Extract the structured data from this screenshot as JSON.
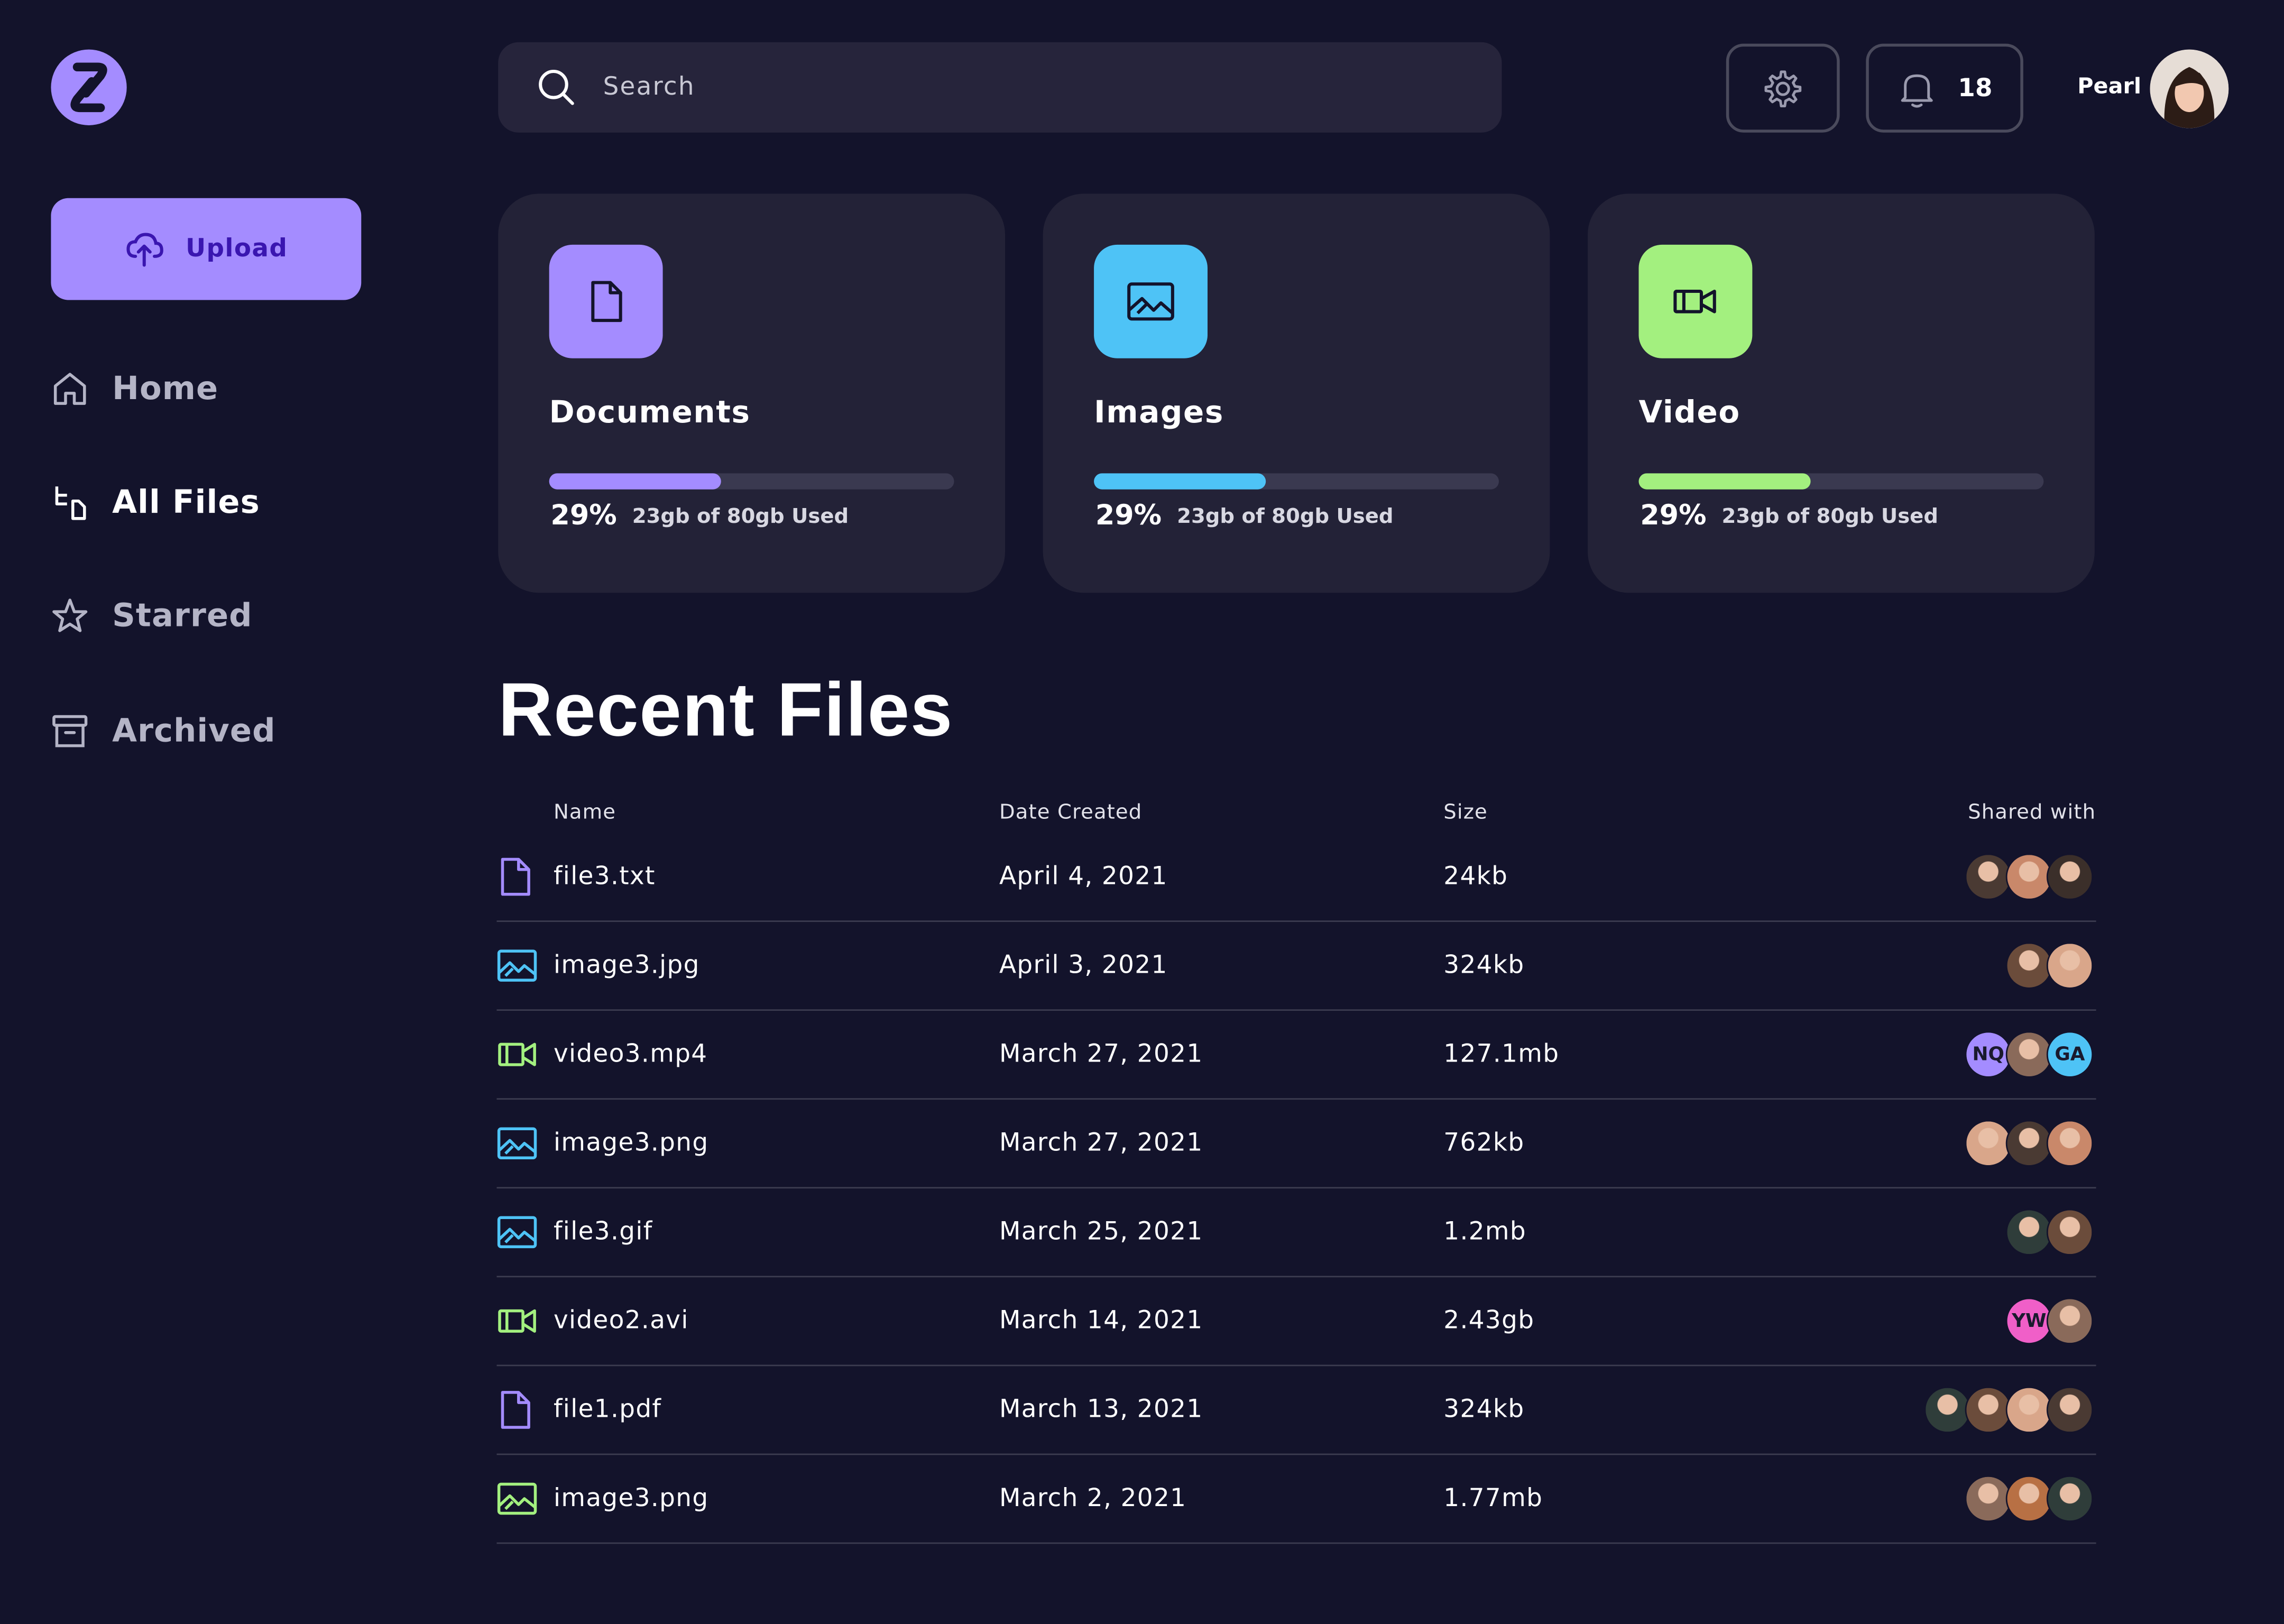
{
  "sidebar": {
    "upload_label": "Upload",
    "nav": [
      {
        "label": "Home",
        "icon": "home-icon",
        "active": false
      },
      {
        "label": "All Files",
        "icon": "files-icon",
        "active": true
      },
      {
        "label": "Starred",
        "icon": "star-icon",
        "active": false
      },
      {
        "label": "Archived",
        "icon": "archive-icon",
        "active": false
      }
    ]
  },
  "header": {
    "search_placeholder": "Search",
    "notification_count": "18",
    "user_name": "Pearl"
  },
  "storage": [
    {
      "name": "Documents",
      "percent": "29%",
      "fraction": 0.29,
      "used": "23gb of 80gb Used",
      "color": "#a48cff",
      "icon": "document-icon"
    },
    {
      "name": "Images",
      "percent": "29%",
      "fraction": 0.29,
      "used": "23gb of 80gb Used",
      "color": "#4ec3f6",
      "icon": "image-icon"
    },
    {
      "name": "Video",
      "percent": "29%",
      "fraction": 0.29,
      "used": "23gb of 80gb Used",
      "color": "#a3f07f",
      "icon": "video-icon"
    }
  ],
  "recent": {
    "title": "Recent Files",
    "columns": {
      "name": "Name",
      "date": "Date Created",
      "size": "Size",
      "shared": "Shared with"
    },
    "files": [
      {
        "name": "file3.txt",
        "type": "document",
        "date": "April 4, 2021",
        "size": "24kb",
        "shared": [
          "photo",
          "photo",
          "photo"
        ]
      },
      {
        "name": "image3.jpg",
        "type": "image",
        "date": "April 3, 2021",
        "size": "324kb",
        "shared": [
          "photo",
          "photo"
        ]
      },
      {
        "name": "video3.mp4",
        "type": "video",
        "date": "March 27, 2021",
        "size": "127.1mb",
        "shared": [
          "NQ",
          "photo",
          "GA"
        ]
      },
      {
        "name": "image3.png",
        "type": "image",
        "date": "March 27, 2021",
        "size": "762kb",
        "shared": [
          "photo",
          "photo",
          "photo"
        ]
      },
      {
        "name": "file3.gif",
        "type": "image",
        "date": "March 25, 2021",
        "size": "1.2mb",
        "shared": [
          "photo",
          "photo"
        ]
      },
      {
        "name": "video2.avi",
        "type": "video",
        "date": "March 14, 2021",
        "size": "2.43gb",
        "shared": [
          "YW",
          "photo"
        ]
      },
      {
        "name": "file1.pdf",
        "type": "document",
        "date": "March 13, 2021",
        "size": "324kb",
        "shared": [
          "photo",
          "photo",
          "photo",
          "photo"
        ]
      },
      {
        "name": "image3.png",
        "type": "image-green",
        "date": "March 2, 2021",
        "size": "1.77mb",
        "shared": [
          "photo",
          "photo",
          "photo"
        ]
      }
    ]
  },
  "colors": {
    "background": "#13132b",
    "card": "#232237",
    "accent": "#a48cff",
    "image": "#4ec3f6",
    "video": "#a3f07f",
    "initials_purple": "#a48cff",
    "initials_blue": "#4ec3f6",
    "initials_pink": "#f05fc8"
  }
}
